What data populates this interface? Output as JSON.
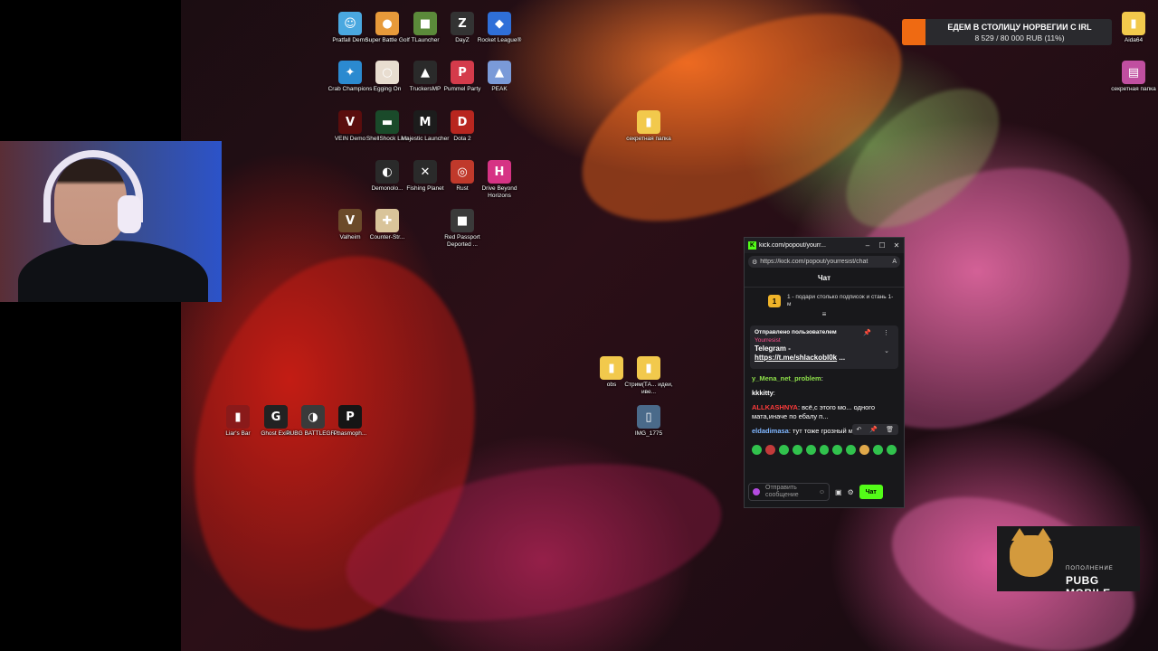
{
  "desktop_icons": [
    {
      "label": "Pratfall Demo",
      "glyph": "☺",
      "color": "#4aa8e0"
    },
    {
      "label": "Super Battle Golf",
      "glyph": "●",
      "color": "#e79a3a"
    },
    {
      "label": "TLauncher",
      "glyph": "■",
      "color": "#5b8a3a"
    },
    {
      "label": "DayZ",
      "glyph": "Z",
      "color": "#333333"
    },
    {
      "label": "Rocket League®",
      "glyph": "◆",
      "color": "#2f6fd8"
    },
    {
      "label": "Crab Champions",
      "glyph": "✦",
      "color": "#2b8ad0"
    },
    {
      "label": "Egging On",
      "glyph": "○",
      "color": "#e8ddd0"
    },
    {
      "label": "TruckersMP",
      "glyph": "▲",
      "color": "#2a2a2a"
    },
    {
      "label": "Pummel Party",
      "glyph": "P",
      "color": "#d43b4b"
    },
    {
      "label": "PEAK",
      "glyph": "▲",
      "color": "#7a9ad8"
    },
    {
      "label": "VEIN Demo",
      "glyph": "V",
      "color": "#5a0d0d"
    },
    {
      "label": "ShellShock Live",
      "glyph": "▬",
      "color": "#1a4a2a"
    },
    {
      "label": "Majestic Launcher",
      "glyph": "M",
      "color": "#1c1c1c"
    },
    {
      "label": "Dota 2",
      "glyph": "D",
      "color": "#b8261f"
    },
    {
      "label": "секретная папка",
      "glyph": "▮",
      "color": "#f2c94c"
    },
    {
      "label": "Demonolo...",
      "glyph": "◐",
      "color": "#2a2a2a"
    },
    {
      "label": "Fishing Planet",
      "glyph": "✕",
      "color": "#2a2a2a"
    },
    {
      "label": "Rust",
      "glyph": "◎",
      "color": "#c0392b"
    },
    {
      "label": "Drive Beyond Horizons",
      "glyph": "H",
      "color": "#d63384"
    },
    {
      "label": "Valheim",
      "glyph": "V",
      "color": "#6b4a2a"
    },
    {
      "label": "Counter-Str...",
      "glyph": "✚",
      "color": "#d9c49a"
    },
    {
      "label": "Red Passport Deported ...",
      "glyph": "■",
      "color": "#3a3a3a"
    },
    {
      "label": "obs",
      "glyph": "▮",
      "color": "#f2c94c"
    },
    {
      "label": "Стрим(ТА... идеи, иве...",
      "glyph": "▮",
      "color": "#f2c94c"
    },
    {
      "label": "IMG_1775",
      "glyph": "▯",
      "color": "#4a6a8a"
    },
    {
      "label": "Liar's Bar",
      "glyph": "▮",
      "color": "#8a1a1a"
    },
    {
      "label": "Ghost Exile",
      "glyph": "G",
      "color": "#222222"
    },
    {
      "label": "PUBG BATTLEGR...",
      "glyph": "◑",
      "color": "#3a3a3a"
    },
    {
      "label": "Phasmoph...",
      "glyph": "P",
      "color": "#151515"
    },
    {
      "label": "Aida64",
      "glyph": "▮",
      "color": "#f2c94c"
    },
    {
      "label": "секретная папка",
      "glyph": "▤",
      "color": "#c04fa0"
    }
  ],
  "goal": {
    "title": "ЕДЕМ В СТОЛИЦУ НОРВЕГИИ С IRL",
    "amount": "8 529 / 80 000 RUB (11%)",
    "progress": 0.11,
    "accent": "#ef6a12"
  },
  "chat": {
    "window_title": "kick.com/popout/yourr...",
    "url": "https://kick.com/popout/yourresist/chat",
    "header": "Чат",
    "gift_rank": "1",
    "gift_text": "1 - подари столько подписок и стань 1-м",
    "pinned": {
      "heading": "Отправлено пользователем",
      "user": "Yourresist",
      "message": "Telegram -",
      "link": "https://t.me/shlackobl0k",
      "more": "..."
    },
    "messages": [
      {
        "user": "y_Mena_net_problem",
        "text": ":",
        "user_color": "#8ee04a"
      },
      {
        "user": "kkkitty",
        "text": ":",
        "user_color": "#ffffff"
      },
      {
        "user": "ALLKASHNYA",
        "text": ": всё,с этого мо... одного мата,иначе по ебалу п...",
        "user_color": "#ff3b3b"
      },
      {
        "user": "eldadimasa",
        "text": ": тут тоже грозный модер?",
        "user_color": "#7fb6ff"
      }
    ],
    "input_placeholder": "Отправить сообщение",
    "send_label": "Чат",
    "accent": "#53fc18"
  },
  "logo": {
    "sub": "ПОПОЛНЕНИЕ",
    "main": "PUBG MOBILE"
  }
}
